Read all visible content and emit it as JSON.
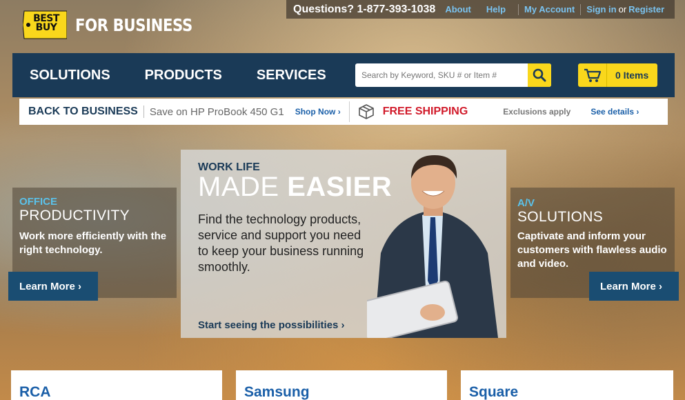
{
  "topbar": {
    "questions": "Questions? 1-877-393-1038",
    "about": "About",
    "help": "Help",
    "my_account": "My Account",
    "sign_in": "Sign in",
    "or": "or",
    "register": "Register"
  },
  "brand": {
    "logo_text": "BEST BUY",
    "tagline": "FOR BUSINESS"
  },
  "nav": {
    "items": [
      "SOLUTIONS",
      "PRODUCTS",
      "SERVICES"
    ],
    "search_placeholder": "Search by Keyword, SKU # or Item #",
    "cart_label": "0 Items"
  },
  "promo": {
    "back": "BACK TO BUSINESS",
    "save": "Save on HP ProBook 450 G1",
    "shop_now": "Shop Now ›",
    "free_shipping": "FREE SHIPPING",
    "exclusions": "Exclusions apply",
    "see_details": "See details ›"
  },
  "left_card": {
    "kicker": "OFFICE",
    "title": "PRODUCTIVITY",
    "body": "Work more efficiently with the right technology.",
    "button": "Learn More ›"
  },
  "hero": {
    "kicker": "WORK LIFE",
    "title_light": "MADE",
    "title_bold": "EASIER",
    "body": "Find the technology products, service and support you need to keep your business running smoothly.",
    "cta": "Start seeing the possibilities ›"
  },
  "right_card": {
    "kicker": "A/V",
    "title": "SOLUTIONS",
    "body": "Captivate and inform your customers with flawless audio and video.",
    "button": "Learn More ›"
  },
  "brands": [
    "RCA",
    "Samsung",
    "Square"
  ],
  "colors": {
    "navy": "#1a3a57",
    "yellow": "#f9d71c",
    "link_blue": "#1a5fa8",
    "red": "#d11a2a",
    "cyan": "#5bc2ea"
  }
}
